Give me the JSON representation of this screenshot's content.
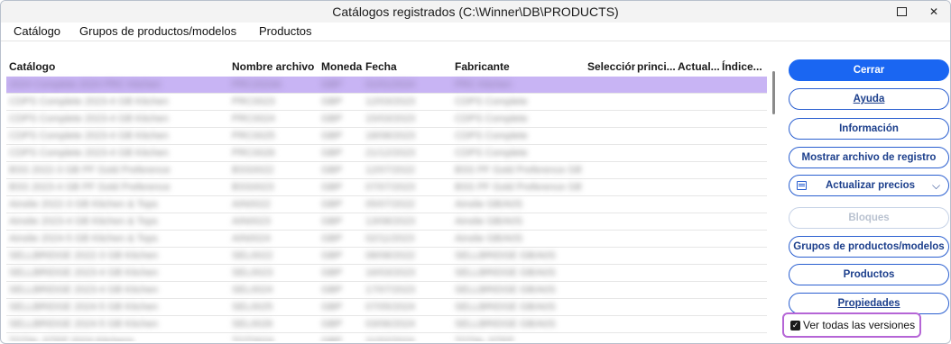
{
  "window": {
    "title": "Catálogos registrados (C:\\Winner\\DB\\PRODUCTS)",
    "maximize_glyph": "□",
    "close_glyph": "✕"
  },
  "menu": [
    "Catálogo",
    "Grupos de productos/modelos",
    "Productos"
  ],
  "table": {
    "columns": [
      "Catálogo",
      "Nombre archivo",
      "Moneda",
      "Fecha",
      "Fabricante",
      "Selección",
      "princi...",
      "Actual...",
      "Índice..."
    ],
    "rows": [
      [
        "2024 Complete 2024 PRC Kitchen",
        "PRC2024A",
        "GBP",
        "01/01/2024",
        "PRC Kitchen",
        "",
        "",
        "",
        ""
      ],
      [
        "CDPS Complete 2023-4 GB Kitchen",
        "PRC0023",
        "GBP",
        "12/03/2023",
        "CDPS Complete",
        "",
        "",
        "",
        ""
      ],
      [
        "CDPS Complete 2023-4 GB Kitchen",
        "PRC0024",
        "GBP",
        "15/03/2023",
        "CDPS Complete",
        "",
        "",
        "",
        ""
      ],
      [
        "CDPS Complete 2023-4 GB Kitchen",
        "PRC0025",
        "GBP",
        "18/08/2023",
        "CDPS Complete",
        "",
        "",
        "",
        ""
      ],
      [
        "CDPS Complete 2023-4 GB Kitchen",
        "PRC0026",
        "GBP",
        "21/12/2023",
        "CDPS Complete",
        "",
        "",
        "",
        ""
      ],
      [
        "BSS 2022-3 GB PF Gold Preference",
        "BSS0022",
        "GBP",
        "12/07/2022",
        "BSS PF Gold Preference GB",
        "",
        "",
        "",
        ""
      ],
      [
        "BSS 2023-4 GB PF Gold Preference",
        "BSS0023",
        "GBP",
        "07/07/2023",
        "BSS PF Gold Preference GB",
        "",
        "",
        "",
        ""
      ],
      [
        "Ainslie 2022-3 GB Kitchen & Tops",
        "AIN0022",
        "GBP",
        "05/07/2022",
        "Ainslie GB/A0S",
        "",
        "",
        "",
        ""
      ],
      [
        "Ainslie 2023-4 GB Kitchen & Tops",
        "AIN0023",
        "GBP",
        "13/08/2023",
        "Ainslie GB/A0S",
        "",
        "",
        "",
        ""
      ],
      [
        "Ainslie 2024-5 GB Kitchen & Tops",
        "AIN0024",
        "GBP",
        "02/11/2023",
        "Ainslie GB/A0S",
        "",
        "",
        "",
        ""
      ],
      [
        "SELLBRIDGE 2022-3 GB Kitchen",
        "SEL0022",
        "GBP",
        "08/08/2022",
        "SELLBRIDGE GB/A0S",
        "",
        "",
        "",
        ""
      ],
      [
        "SELLBRIDGE 2023-4 GB Kitchen",
        "SEL0023",
        "GBP",
        "16/03/2023",
        "SELLBRIDGE GB/A0S",
        "",
        "",
        "",
        ""
      ],
      [
        "SELLBRIDGE 2023-4 GB Kitchen",
        "SEL0024",
        "GBP",
        "17/07/2023",
        "SELLBRIDGE GB/A0S",
        "",
        "",
        "",
        ""
      ],
      [
        "SELLBRIDGE 2024-5 GB Kitchen",
        "SEL0025",
        "GBP",
        "07/05/2024",
        "SELLBRIDGE GB/A0S",
        "",
        "",
        "",
        ""
      ],
      [
        "SELLBRIDGE 2024-5 GB Kitchen",
        "SEL0026",
        "GBP",
        "03/06/2024",
        "SELLBRIDGE GB/A0S",
        "",
        "",
        "",
        ""
      ],
      [
        "TOTAL STEP 2024 Kitchens",
        "TOT0024",
        "GBP",
        "11/02/2024",
        "TOTAL STEP",
        "",
        "",
        "",
        ""
      ]
    ]
  },
  "buttons": {
    "cerrar": "Cerrar",
    "ayuda": "Ayuda",
    "informacion": "Información",
    "mostrar_registro": "Mostrar archivo de registro",
    "actualizar_precios": "Actualizar precios",
    "bloques": "Bloques",
    "grupos": "Grupos de productos/modelos",
    "productos": "Productos",
    "propiedades": "Propiedades"
  },
  "dropdown_chevron": "⌵",
  "ver_todas": {
    "label": "Ver todas las versiones",
    "checked": true,
    "check_glyph": "✓"
  },
  "icons": {
    "maximize": "maximize-icon",
    "close": "close-icon",
    "price_update": "calendar-grid-icon",
    "chevron": "chevron-down-icon",
    "checkbox": "checkbox-checked-icon"
  },
  "colors": {
    "primary_button": "#1a66f2",
    "selected_row": "#c8b4f4",
    "highlight_frame": "#b565d6",
    "button_border": "#2a5fd0"
  }
}
